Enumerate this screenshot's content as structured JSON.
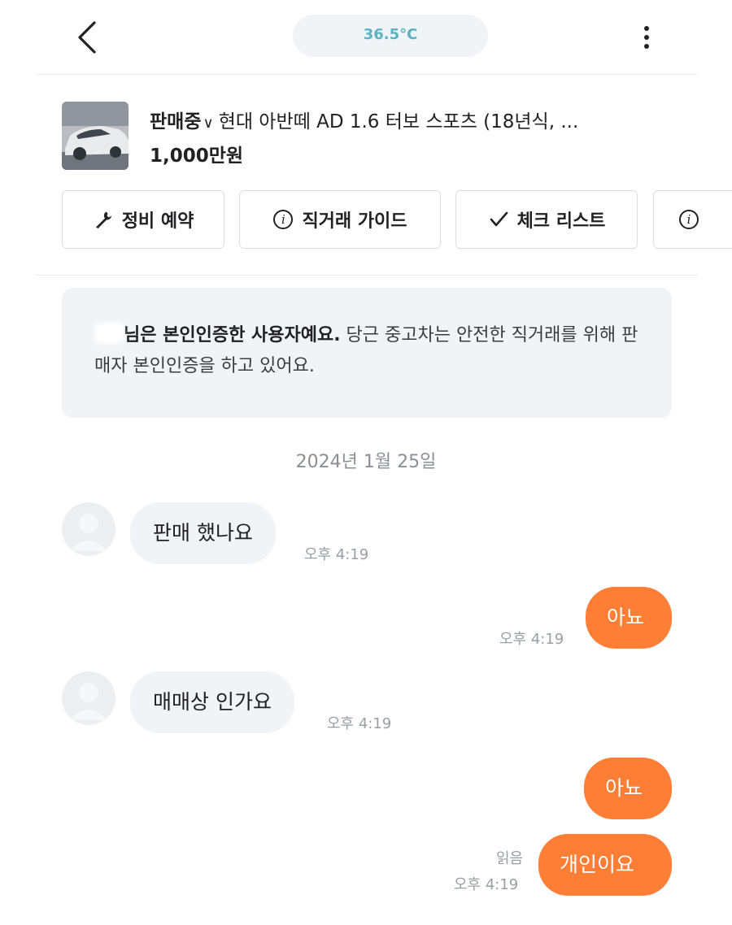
{
  "header": {
    "temperature": "36.5°C"
  },
  "product": {
    "status": "판매중",
    "title": "현대 아반떼 AD 1.6 터보 스포츠 (18년식, ...",
    "price": "1,000만원"
  },
  "actions": [
    {
      "label": "정비 예약",
      "icon": "wrench-icon"
    },
    {
      "label": "직거래 가이드",
      "icon": "info-icon"
    },
    {
      "label": "체크 리스트",
      "icon": "check-icon"
    },
    {
      "label": "",
      "icon": "info-icon"
    }
  ],
  "notice": {
    "bold": "님은 본인인증한 사용자예요.",
    "text": " 당근 중고차는 안전한 직거래를 위해 판매자 본인인증을 하고 있어요."
  },
  "date": "2024년 1월 25일",
  "messages": [
    {
      "from": "other",
      "text": "판매 했나요",
      "time": "오후 4:19"
    },
    {
      "from": "me",
      "text": "아뇨",
      "time": "오후 4:19"
    },
    {
      "from": "other",
      "text": "매매상 인가요",
      "time": "오후 4:19"
    },
    {
      "from": "me",
      "text": "아뇨",
      "time": ""
    },
    {
      "from": "me",
      "text": "개인이요",
      "time": "오후 4:19",
      "read": "읽음"
    }
  ],
  "colors": {
    "accent": "#ff7e36",
    "temperature": "#5ab3c4",
    "bubble_in": "#f2f3f6"
  }
}
